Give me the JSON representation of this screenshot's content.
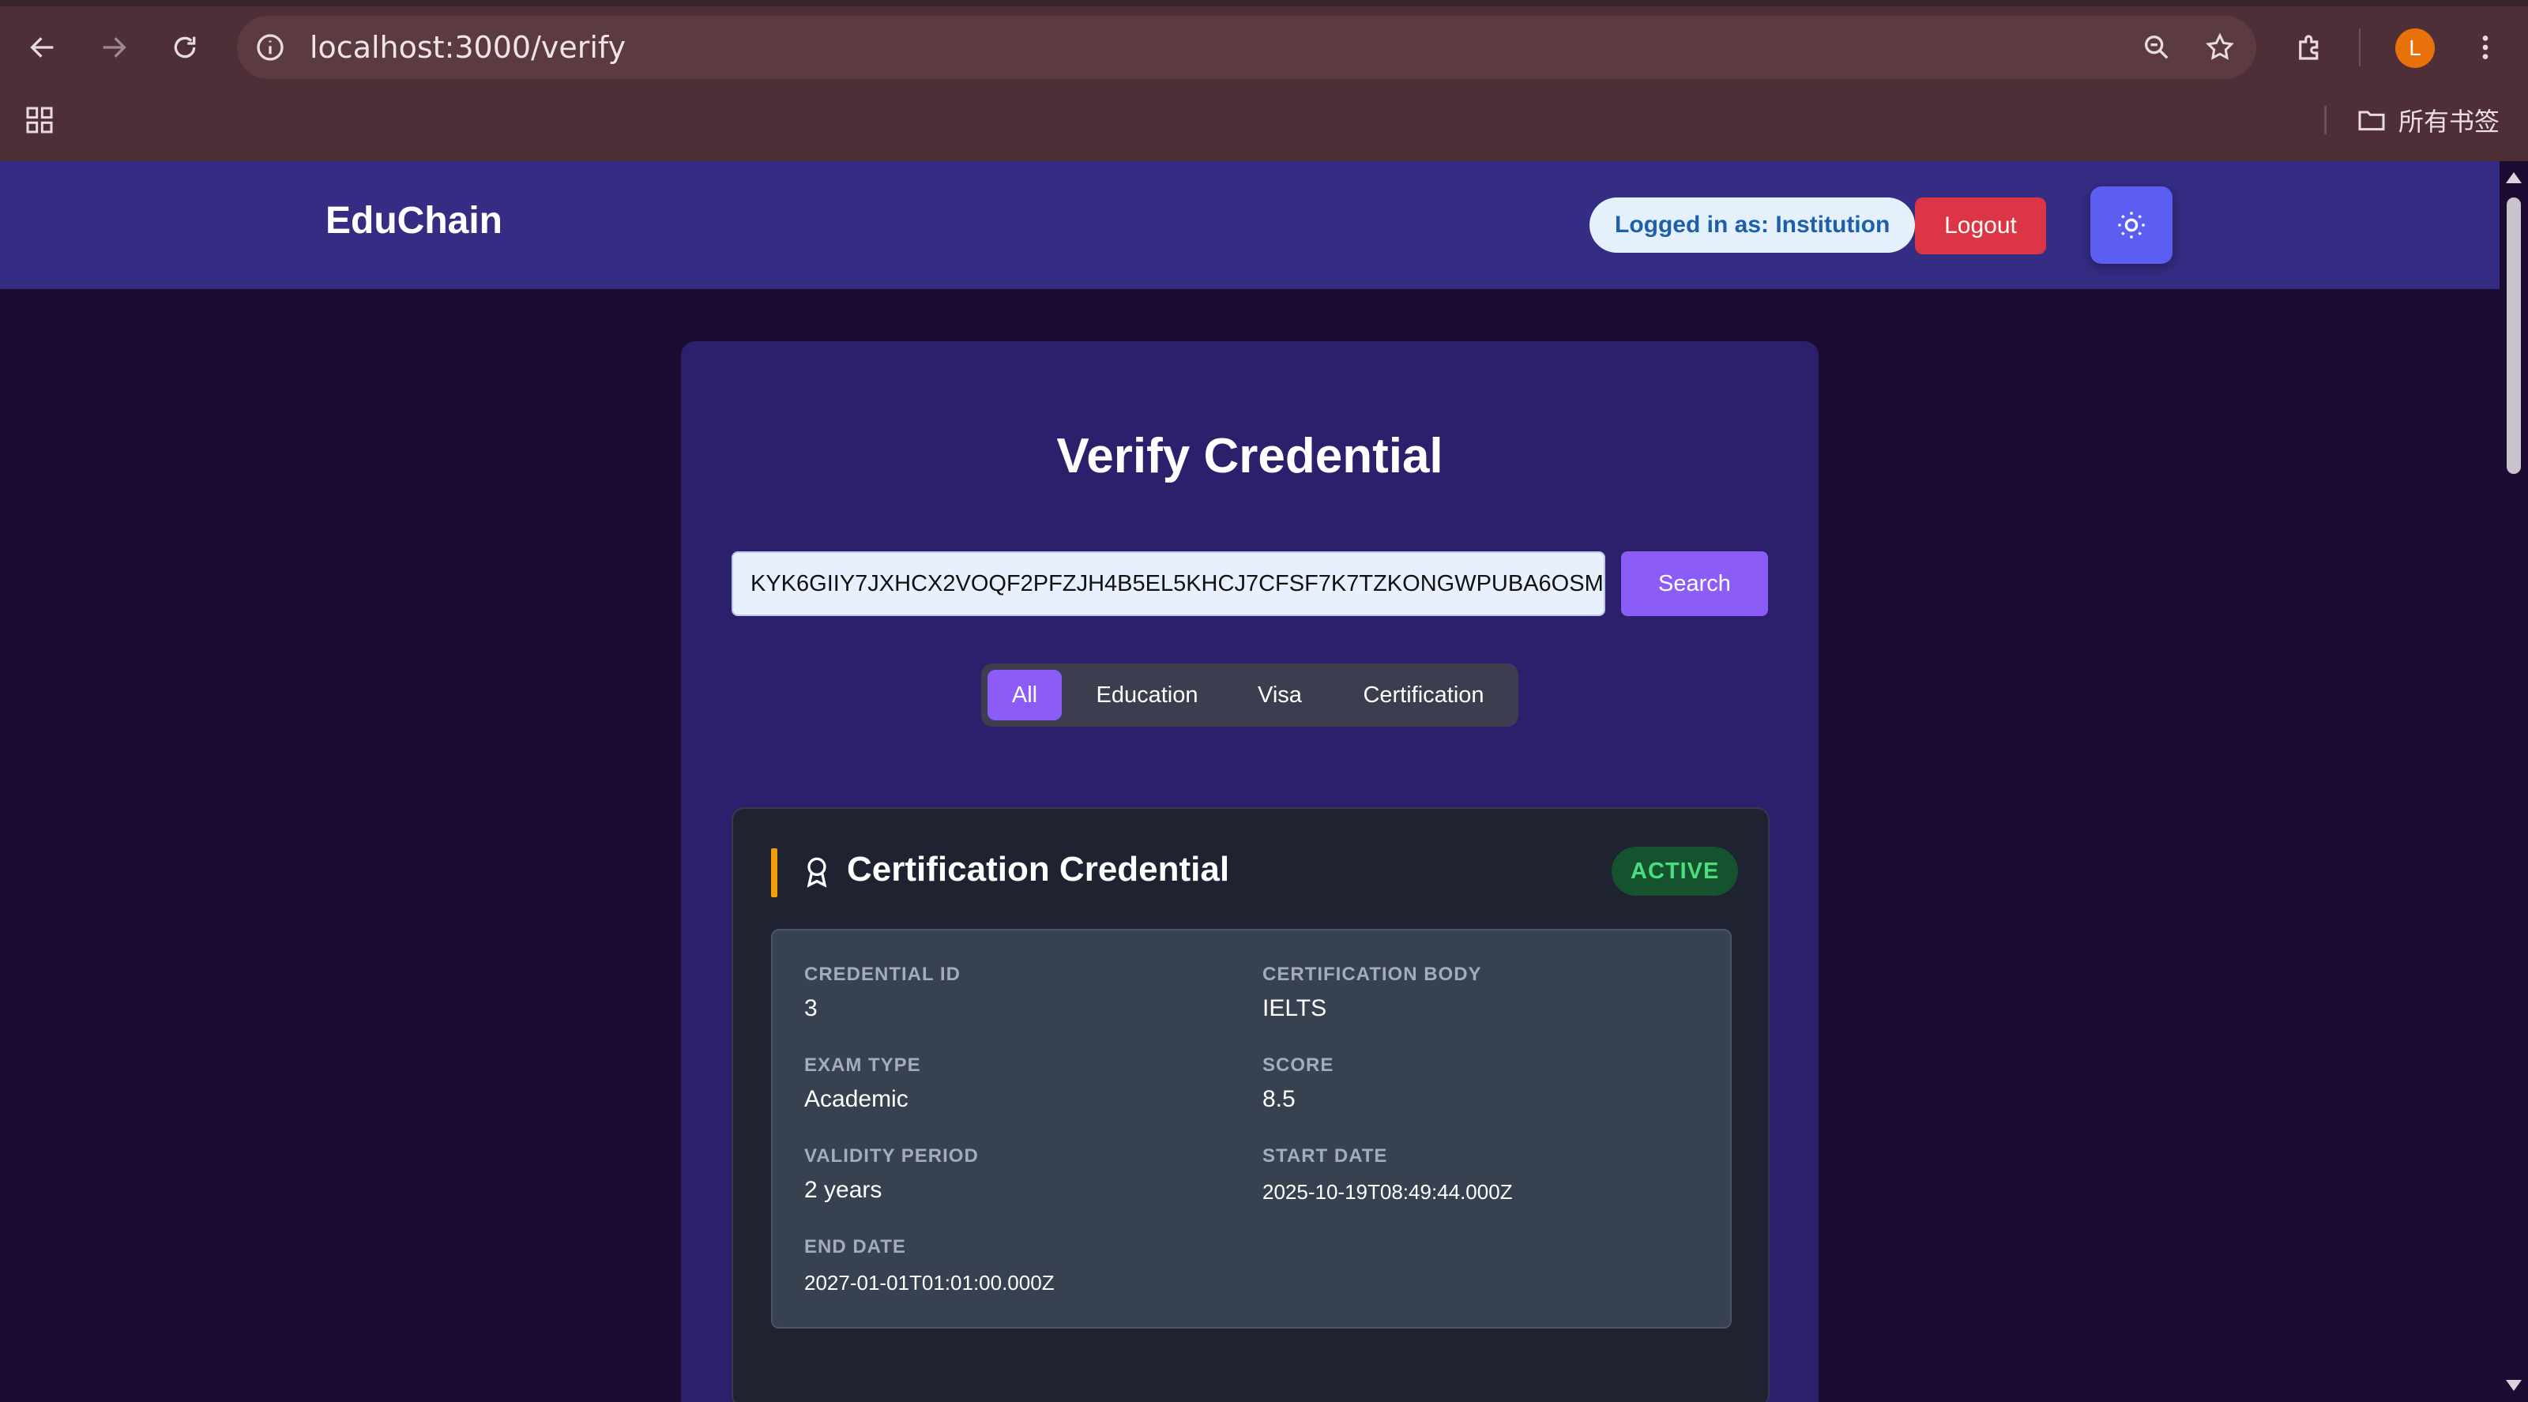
{
  "browser": {
    "url": "localhost:3000/verify",
    "profile_initial": "L",
    "bookmarks_folder": "所有书签"
  },
  "header": {
    "brand": "EduChain",
    "login_status": "Logged in as: Institution",
    "logout_label": "Logout"
  },
  "main": {
    "title": "Verify Credential",
    "search_value": "KYK6GIIY7JXHCX2VOQF2PFZJH4B5EL5KHCJ7CFSF7K7TZKONGWPUBA6OSM",
    "search_label": "Search",
    "filters": [
      "All",
      "Education",
      "Visa",
      "Certification"
    ],
    "active_filter": "All"
  },
  "credential": {
    "title": "Certification Credential",
    "status": "ACTIVE",
    "fields": {
      "credential_id": {
        "label": "CREDENTIAL ID",
        "value": "3"
      },
      "certification_body": {
        "label": "CERTIFICATION BODY",
        "value": "IELTS"
      },
      "exam_type": {
        "label": "EXAM TYPE",
        "value": "Academic"
      },
      "score": {
        "label": "SCORE",
        "value": "8.5"
      },
      "validity_period": {
        "label": "VALIDITY PERIOD",
        "value": "2 years"
      },
      "start_date": {
        "label": "START DATE",
        "value": "2025-10-19T08:49:44.000Z"
      },
      "end_date": {
        "label": "END DATE",
        "value": "2027-01-01T01:01:00.000Z"
      }
    }
  },
  "colors": {
    "header_bg": "#352c84",
    "page_bg": "#1c0b33",
    "accent_purple": "#8b5cf6",
    "logout_red": "#dc3545",
    "status_green": "#4ade80",
    "accent_amber": "#f59e0b"
  }
}
